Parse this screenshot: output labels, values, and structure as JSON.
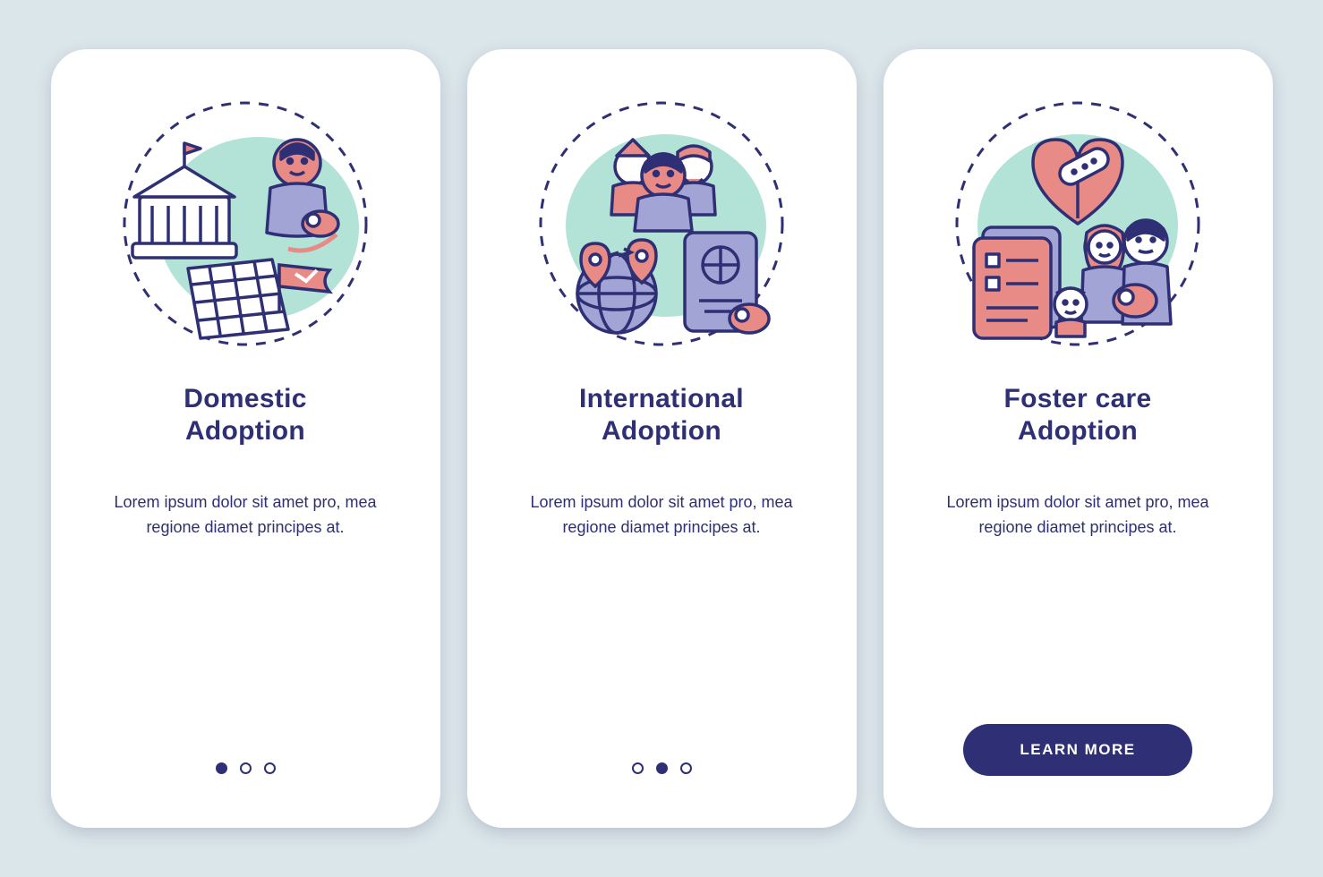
{
  "colors": {
    "bg": "#dbe6eb",
    "card": "#ffffff",
    "ink": "#2e2f74",
    "accent1": "#e88a86",
    "accent2": "#b3e3d6",
    "accent3": "#a1a4d4"
  },
  "screens": [
    {
      "id": "domestic",
      "title_line1": "Domestic",
      "title_line2": "Adoption",
      "body": "Lorem ipsum dolor sit amet pro, mea regione diamet principes at.",
      "icon": "domestic-adoption-icon",
      "pager": {
        "total": 3,
        "active": 0
      }
    },
    {
      "id": "international",
      "title_line1": "International",
      "title_line2": "Adoption",
      "body": "Lorem ipsum dolor sit amet pro, mea regione diamet principes at.",
      "icon": "international-adoption-icon",
      "pager": {
        "total": 3,
        "active": 1
      }
    },
    {
      "id": "foster",
      "title_line1": "Foster care",
      "title_line2": "Adoption",
      "body": "Lorem ipsum dolor sit amet pro, mea regione diamet principes at.",
      "icon": "foster-care-adoption-icon",
      "cta_label": "LEARN MORE"
    }
  ]
}
